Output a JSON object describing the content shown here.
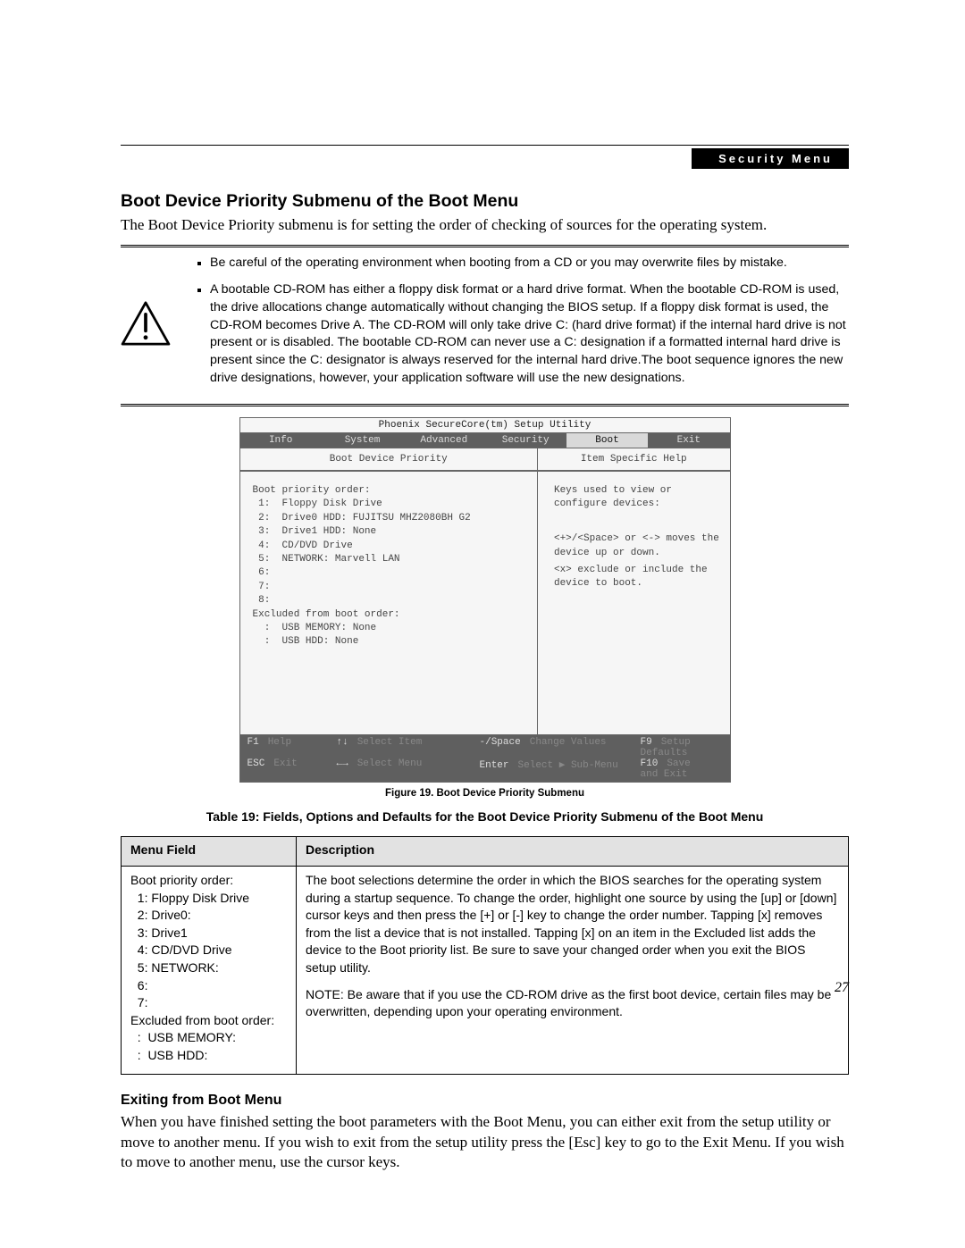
{
  "header": {
    "security_tag": "Security Menu"
  },
  "section": {
    "title": "Boot Device Priority Submenu of the Boot Menu",
    "intro": "The Boot Device Priority submenu is for setting the order of checking of sources for the operating system."
  },
  "warning": {
    "bullet1": "Be careful of the operating environment when booting from a CD or you may overwrite files by mistake.",
    "bullet2": "A bootable CD-ROM has either a floppy disk format or a hard drive format. When the bootable CD-ROM is used, the drive allocations change automatically without changing the BIOS setup. If a floppy disk format is used, the CD-ROM becomes Drive A. The CD-ROM will only take drive C: (hard drive format) if the internal hard drive is not present or is disabled. The bootable CD-ROM can never use a C: designation if a formatted internal hard drive is present since the C: designator is always reserved for the internal hard drive.The boot sequence ignores the new drive designations, however, your application software will use the new designations."
  },
  "bios": {
    "title": "Phoenix SecureCore(tm) Setup Utility",
    "tabs": [
      "Info",
      "System",
      "Advanced",
      "Security",
      "Boot",
      "Exit"
    ],
    "active_tab": "Boot",
    "left_heading": "Boot Device Priority",
    "right_heading": "Item Specific Help",
    "boot_order_label": "Boot priority order:",
    "boot_items": [
      " 1:  Floppy Disk Drive",
      " 2:  Drive0 HDD: FUJITSU MHZ2080BH G2",
      " 3:  Drive1 HDD: None",
      " 4:  CD/DVD Drive",
      " 5:  NETWORK: Marvell LAN",
      " 6:",
      " 7:",
      " 8:"
    ],
    "excluded_label": "Excluded from boot order:",
    "excluded_items": [
      "  :  USB MEMORY: None",
      "  :  USB HDD: None"
    ],
    "help_lines": [
      "Keys used to view or configure devices:",
      "<+>/<Space> or <-> moves the device up or down.",
      "<x> exclude or include the device to boot."
    ],
    "footer": {
      "row1": [
        {
          "key": "F1",
          "label": "Help"
        },
        {
          "key": "↑↓",
          "label": "Select Item"
        },
        {
          "key": "-/Space",
          "label": "Change Values"
        },
        {
          "key": "F9",
          "label": "Setup Defaults"
        }
      ],
      "row2": [
        {
          "key": "ESC",
          "label": "Exit"
        },
        {
          "key": "←→",
          "label": "Select Menu"
        },
        {
          "key": "Enter",
          "label": "Select ▶ Sub-Menu"
        },
        {
          "key": "F10",
          "label": "Save and Exit"
        }
      ]
    }
  },
  "figure_caption": "Figure 19.  Boot Device Priority Submenu",
  "table_caption": "Table 19: Fields, Options and Defaults for the Boot Device Priority Submenu of the Boot Menu",
  "table": {
    "headers": [
      "Menu Field",
      "Description"
    ],
    "menu_text": "Boot priority order:\n  1: Floppy Disk Drive\n  2: Drive0:\n  3: Drive1\n  4: CD/DVD Drive\n  5: NETWORK:\n  6:\n  7:\nExcluded from boot order:\n  :  USB MEMORY:\n  :  USB HDD:",
    "desc_para1": "The boot selections determine the order in which the BIOS searches for the operating system during a startup sequence. To change the order, highlight one source by using the [up] or [down] cursor keys and then press the [+] or [-] key to change the order number. Tapping [x] removes from the list a device that is not installed. Tapping [x] on an item in the Excluded list adds the device to the Boot priority list. Be sure to save your changed order when you exit the BIOS setup utility.",
    "desc_para2": "NOTE: Be aware that if you use the CD-ROM drive as the first boot device, certain files may be overwritten, depending upon your operating environment."
  },
  "exit_section": {
    "heading": "Exiting from Boot Menu",
    "body": "When you have finished setting the boot parameters with the Boot Menu, you can either exit from the setup utility or move to another menu. If you wish to exit from the setup utility press the [Esc] key to go to the Exit Menu. If you wish to move to another menu, use the cursor keys."
  },
  "page_number": "27"
}
